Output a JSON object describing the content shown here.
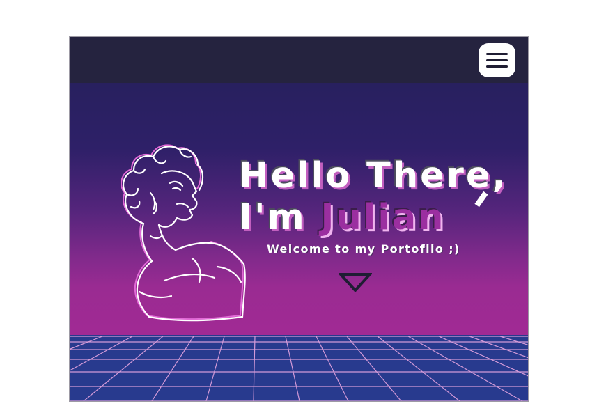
{
  "hero": {
    "line1": "Hello There,",
    "line2_prefix": "I'm",
    "name": "Julian",
    "welcome": "Welcome to my Portoflio ;)"
  },
  "icons": {
    "menu": "hamburger-menu-icon",
    "scroll": "down-triangle-arrow-icon",
    "bust": "bust-line-art-icon"
  },
  "colors": {
    "navbar": "#25233f",
    "gradient_top": "#28205f",
    "gradient_bottom": "#a12a94",
    "name_accent": "#9b2fa0",
    "grid_floor": "#283a8e",
    "grid_lines": "#d39ad8"
  }
}
